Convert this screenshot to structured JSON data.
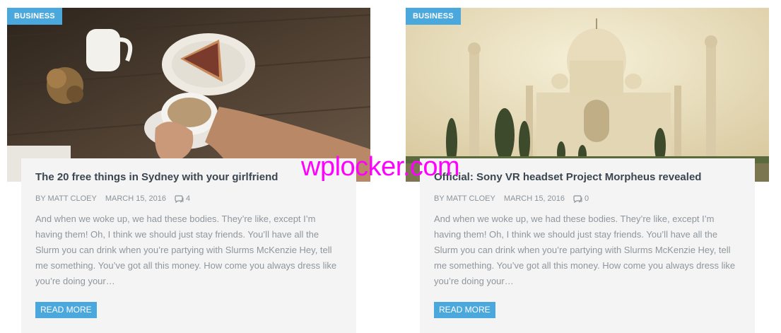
{
  "posts": [
    {
      "category": "BUSINESS",
      "title": "The 20 free things in Sydney with your girlfriend",
      "author": "BY MATT CLOEY",
      "date": "MARCH 15, 2016",
      "comments": "4",
      "excerpt": "And when we woke up, we had these bodies. They’re like, except I’m having them! Oh, I think we should just stay friends. You’ll have all the Slurm you can drink when you’re partying with Slurms McKenzie Hey, tell me something. You’ve got all this money. How come you always dress like you’re doing your…",
      "read_more": "READ MORE",
      "image": "coffee-and-cake-photo"
    },
    {
      "category": "BUSINESS",
      "title": "Official: Sony VR headset Project Morpheus revealed",
      "author": "BY MATT CLOEY",
      "date": "MARCH 15, 2016",
      "comments": "0",
      "excerpt": "And when we woke up, we had these bodies. They’re like, except I’m having them! Oh, I think we should just stay friends. You’ll have all the Slurm you can drink when you’re partying with Slurms McKenzie Hey, tell me something. You’ve got all this money. How come you always dress like you’re doing your…",
      "read_more": "READ MORE",
      "image": "taj-mahal-photo"
    }
  ],
  "watermark": "wplocker.com",
  "colors": {
    "accent": "#4aa8dc",
    "panel": "#f4f4f4",
    "watermark": "#ff00ff"
  }
}
